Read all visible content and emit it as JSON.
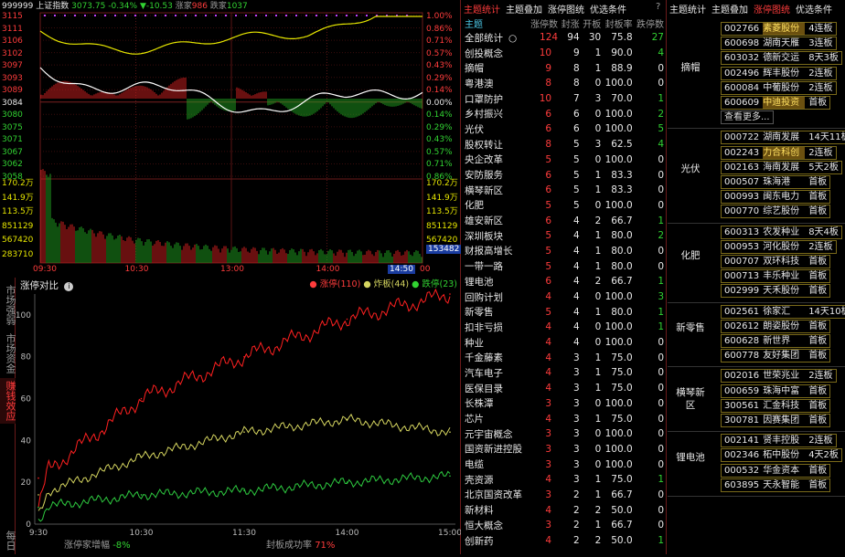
{
  "index_header": {
    "code": "999999",
    "name": "上证指数",
    "price": "3073.75",
    "pct": "-0.34%",
    "change": "▼-10.53",
    "up_label": "涨家",
    "up_count": "986",
    "down_label": "跌家",
    "down_count": "1037"
  },
  "price_axis_left": [
    "3115",
    "3111",
    "3106",
    "3102",
    "3097",
    "3093",
    "3089",
    "3084",
    "3080",
    "3075",
    "3071",
    "3067",
    "3062",
    "3058"
  ],
  "price_axis_right": [
    "1.00%",
    "0.86%",
    "0.71%",
    "0.57%",
    "0.43%",
    "0.29%",
    "0.14%",
    "0.00%",
    "0.14%",
    "0.29%",
    "0.43%",
    "0.57%",
    "0.71%",
    "0.86%"
  ],
  "volume_axis_left": [
    "170.2万",
    "141.9万",
    "113.5万",
    "851129",
    "567420",
    "283710"
  ],
  "volume_axis_right": [
    "170.2万",
    "141.9万",
    "113.5万",
    "851129",
    "567420",
    "283710"
  ],
  "volume_current": "153482",
  "time_axis": [
    "09:30",
    "10:30",
    "13:00",
    "14:00"
  ],
  "time_cursor": "14:50",
  "time_end_fragment": "00",
  "limit_chart": {
    "title": "涨停对比",
    "legend": [
      {
        "label": "涨停(110)",
        "color": "#ff3232"
      },
      {
        "label": "炸板(44)",
        "color": "#d6d660"
      },
      {
        "label": "跌停(23)",
        "color": "#2ecc40"
      }
    ],
    "y_ticks": [
      "100",
      "80",
      "60",
      "40",
      "20",
      "0"
    ],
    "x_ticks": [
      "9:30",
      "10:30",
      "11:30",
      "14:00",
      "15:00"
    ],
    "footer_left_label": "涨停家增幅",
    "footer_left_value": "-8%",
    "footer_right_label": "封板成功率",
    "footer_right_value": "71%"
  },
  "side_tabs": [
    "市场强弱",
    "市场资金",
    "赚钱效应",
    "每日"
  ],
  "chart_data": [
    {
      "type": "line",
      "title": "涨停对比",
      "x": [
        "9:30",
        "10:30",
        "11:30",
        "14:00",
        "15:00"
      ],
      "ylim": [
        0,
        110
      ],
      "series": [
        {
          "name": "涨停(110)",
          "values": [
            22,
            60,
            80,
            98,
            110
          ]
        },
        {
          "name": "炸板(44)",
          "values": [
            14,
            32,
            44,
            50,
            44
          ]
        },
        {
          "name": "跌停(23)",
          "values": [
            8,
            14,
            16,
            20,
            23
          ]
        }
      ]
    }
  ],
  "middle": {
    "tabs": [
      "主题统计",
      "主题叠加",
      "涨停图统",
      "优选条件"
    ],
    "help": "?",
    "columns": [
      "主题",
      "涨停数",
      "封涨",
      "开板",
      "封板率",
      "跌停数"
    ],
    "total_row": {
      "name": "全部统计",
      "icon": "○",
      "limit": "124",
      "sealed": "94",
      "opened": "30",
      "rate": "75.8",
      "down": "27"
    },
    "rows": [
      [
        "创投概念",
        "10",
        "9",
        "1",
        "90.0",
        "4"
      ],
      [
        "摘帽",
        "9",
        "8",
        "1",
        "88.9",
        "0"
      ],
      [
        "粤港澳",
        "8",
        "8",
        "0",
        "100.0",
        "0"
      ],
      [
        "口罩防护",
        "10",
        "7",
        "3",
        "70.0",
        "1"
      ],
      [
        "乡村振兴",
        "6",
        "6",
        "0",
        "100.0",
        "2"
      ],
      [
        "光伏",
        "6",
        "6",
        "0",
        "100.0",
        "5"
      ],
      [
        "股权转让",
        "8",
        "5",
        "3",
        "62.5",
        "4"
      ],
      [
        "央企改革",
        "5",
        "5",
        "0",
        "100.0",
        "0"
      ],
      [
        "安防服务",
        "6",
        "5",
        "1",
        "83.3",
        "0"
      ],
      [
        "横琴新区",
        "6",
        "5",
        "1",
        "83.3",
        "0"
      ],
      [
        "化肥",
        "5",
        "5",
        "0",
        "100.0",
        "0"
      ],
      [
        "雄安新区",
        "6",
        "4",
        "2",
        "66.7",
        "1"
      ],
      [
        "深圳板块",
        "5",
        "4",
        "1",
        "80.0",
        "2"
      ],
      [
        "财报高增长",
        "5",
        "4",
        "1",
        "80.0",
        "0"
      ],
      [
        "一带一路",
        "5",
        "4",
        "1",
        "80.0",
        "0"
      ],
      [
        "锂电池",
        "6",
        "4",
        "2",
        "66.7",
        "1"
      ],
      [
        "回购计划",
        "4",
        "4",
        "0",
        "100.0",
        "3"
      ],
      [
        "新零售",
        "5",
        "4",
        "1",
        "80.0",
        "1"
      ],
      [
        "扣非亏损",
        "4",
        "4",
        "0",
        "100.0",
        "1"
      ],
      [
        "种业",
        "4",
        "4",
        "0",
        "100.0",
        "0"
      ],
      [
        "千金藤素",
        "4",
        "3",
        "1",
        "75.0",
        "0"
      ],
      [
        "汽车电子",
        "4",
        "3",
        "1",
        "75.0",
        "0"
      ],
      [
        "医保目录",
        "4",
        "3",
        "1",
        "75.0",
        "0"
      ],
      [
        "长株潭",
        "3",
        "3",
        "0",
        "100.0",
        "0"
      ],
      [
        "芯片",
        "4",
        "3",
        "1",
        "75.0",
        "0"
      ],
      [
        "元宇宙概念",
        "3",
        "3",
        "0",
        "100.0",
        "0"
      ],
      [
        "国资新进控股",
        "3",
        "3",
        "0",
        "100.0",
        "0"
      ],
      [
        "电缆",
        "3",
        "3",
        "0",
        "100.0",
        "0"
      ],
      [
        "壳资源",
        "4",
        "3",
        "1",
        "75.0",
        "1"
      ],
      [
        "北京国资改革",
        "3",
        "2",
        "1",
        "66.7",
        "0"
      ],
      [
        "新材料",
        "4",
        "2",
        "2",
        "50.0",
        "0"
      ],
      [
        "恒大概念",
        "3",
        "2",
        "1",
        "66.7",
        "0"
      ],
      [
        "创新药",
        "4",
        "2",
        "2",
        "50.0",
        "1"
      ]
    ]
  },
  "right": {
    "tabs": [
      "主题统计",
      "主题叠加",
      "涨停图统",
      "优选条件"
    ],
    "groups": [
      {
        "name": "摘帽",
        "stocks": [
          [
            "002766",
            "素菱股份",
            "4连板"
          ],
          [
            "600698",
            "湖南天雁",
            "3连板"
          ],
          [
            "603032",
            "德新交运",
            "8天3板"
          ],
          [
            "002496",
            "辉丰股份",
            "2连板"
          ],
          [
            "600084",
            "中葡股份",
            "2连板"
          ],
          [
            "600609",
            "中迪投资",
            "首板"
          ]
        ],
        "more": "查看更多..."
      },
      {
        "name": "光伏",
        "stocks": [
          [
            "000722",
            "湖南发展",
            "14天11板"
          ],
          [
            "002243",
            "力合科创",
            "2连板"
          ],
          [
            "002163",
            "海南发展",
            "5天2板"
          ],
          [
            "000507",
            "珠海港",
            "首板"
          ],
          [
            "000993",
            "闽东电力",
            "首板"
          ],
          [
            "000770",
            "综艺股份",
            "首板"
          ]
        ]
      },
      {
        "name": "化肥",
        "stocks": [
          [
            "600313",
            "农发种业",
            "8天4板"
          ],
          [
            "000953",
            "河化股份",
            "2连板"
          ],
          [
            "000707",
            "双环科技",
            "首板"
          ],
          [
            "000713",
            "丰乐种业",
            "首板"
          ],
          [
            "002999",
            "天禾股份",
            "首板"
          ]
        ]
      },
      {
        "name": "新零售",
        "stocks": [
          [
            "002561",
            "徐家汇",
            "14天10板"
          ],
          [
            "002612",
            "朗姿股份",
            "首板"
          ],
          [
            "600628",
            "新世界",
            "首板"
          ],
          [
            "600778",
            "友好集团",
            "首板"
          ]
        ]
      },
      {
        "name": "横琴新区",
        "stocks": [
          [
            "002016",
            "世荣兆业",
            "2连板"
          ],
          [
            "000659",
            "珠海中富",
            "首板"
          ],
          [
            "300561",
            "汇金科技",
            "首板"
          ],
          [
            "300781",
            "因赛集团",
            "首板"
          ]
        ]
      },
      {
        "name": "锂电池",
        "stocks": [
          [
            "002141",
            "贤丰控股",
            "2连板"
          ],
          [
            "002346",
            "柘中股份",
            "4天2板"
          ],
          [
            "000532",
            "华金资本",
            "首板"
          ],
          [
            "603895",
            "天永智能",
            "首板"
          ]
        ]
      }
    ]
  }
}
